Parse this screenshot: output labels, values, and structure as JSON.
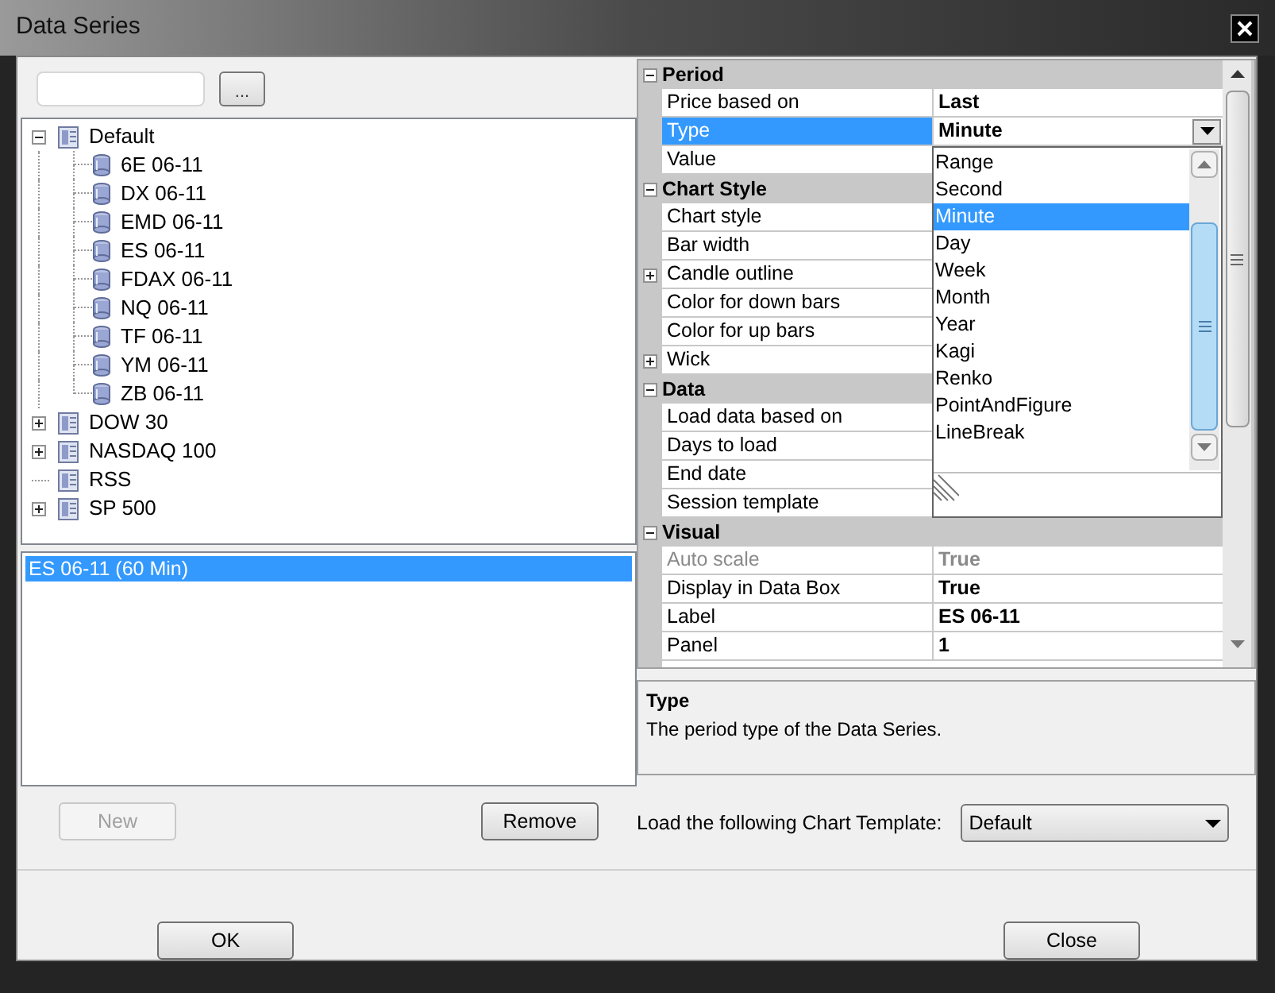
{
  "window": {
    "title": "Data Series"
  },
  "browse_button": "...",
  "tree": [
    {
      "label": "Default",
      "kind": "group",
      "expanded": true,
      "children": [
        {
          "label": "6E 06-11"
        },
        {
          "label": "DX 06-11"
        },
        {
          "label": "EMD 06-11"
        },
        {
          "label": "ES 06-11"
        },
        {
          "label": "FDAX 06-11"
        },
        {
          "label": "NQ 06-11"
        },
        {
          "label": "TF 06-11"
        },
        {
          "label": "YM 06-11"
        },
        {
          "label": "ZB 06-11"
        }
      ]
    },
    {
      "label": "DOW 30",
      "kind": "group",
      "expanded": false
    },
    {
      "label": "NASDAQ 100",
      "kind": "group",
      "expanded": false
    },
    {
      "label": "RSS",
      "kind": "leaf"
    },
    {
      "label": "SP 500",
      "kind": "group",
      "expanded": false
    }
  ],
  "series_list": [
    {
      "label": "ES 06-11 (60 Min)",
      "selected": true
    }
  ],
  "list_buttons": [
    {
      "label": "New",
      "disabled": true
    },
    {
      "label": "Remove",
      "disabled": false
    }
  ],
  "properties": [
    {
      "name": "Period",
      "expanded": true,
      "rows": [
        {
          "name": "Price based on",
          "kind": "plain",
          "value": "Last",
          "selected": false,
          "disabled": false
        },
        {
          "name": "Type",
          "kind": "plain",
          "value": "Minute",
          "selected": true,
          "disabled": false,
          "dropdown": {
            "items": [
              {
                "label": "Range",
                "selected": false
              },
              {
                "label": "Second",
                "selected": false
              },
              {
                "label": "Minute",
                "selected": true
              },
              {
                "label": "Day",
                "selected": false
              },
              {
                "label": "Week",
                "selected": false
              },
              {
                "label": "Month",
                "selected": false
              },
              {
                "label": "Year",
                "selected": false
              },
              {
                "label": "Kagi",
                "selected": false
              },
              {
                "label": "Renko",
                "selected": false
              },
              {
                "label": "PointAndFigure",
                "selected": false
              },
              {
                "label": "LineBreak",
                "selected": false
              }
            ]
          }
        },
        {
          "name": "Value",
          "kind": "plain",
          "selected": false,
          "disabled": false
        }
      ]
    },
    {
      "name": "Chart Style",
      "expanded": true,
      "rows": [
        {
          "name": "Chart style",
          "kind": "plain",
          "selected": false,
          "disabled": false
        },
        {
          "name": "Bar width",
          "kind": "plain",
          "selected": false,
          "disabled": false
        },
        {
          "name": "Candle outline",
          "kind": "group",
          "selected": false,
          "disabled": false
        },
        {
          "name": "Color for down bars",
          "kind": "plain",
          "selected": false,
          "disabled": false
        },
        {
          "name": "Color for up bars",
          "kind": "plain",
          "selected": false,
          "disabled": false
        },
        {
          "name": "Wick",
          "kind": "group",
          "selected": false,
          "disabled": false
        }
      ]
    },
    {
      "name": "Data",
      "expanded": true,
      "rows": [
        {
          "name": "Load data based on",
          "kind": "plain",
          "selected": false,
          "disabled": false
        },
        {
          "name": "Days to load",
          "kind": "plain",
          "selected": false,
          "disabled": false
        },
        {
          "name": "End date",
          "kind": "plain",
          "selected": false,
          "disabled": false
        },
        {
          "name": "Session template",
          "kind": "plain",
          "selected": false,
          "disabled": false
        }
      ]
    },
    {
      "name": "Visual",
      "expanded": true,
      "rows": [
        {
          "name": "Auto scale",
          "kind": "plain",
          "value": "True",
          "selected": false,
          "disabled": true
        },
        {
          "name": "Display in Data Box",
          "kind": "plain",
          "value": "True",
          "selected": false,
          "disabled": false
        },
        {
          "name": "Label",
          "kind": "plain",
          "value": "ES 06-11",
          "selected": false,
          "disabled": false
        },
        {
          "name": "Panel",
          "kind": "plain",
          "value": "1",
          "selected": false,
          "disabled": false
        }
      ]
    }
  ],
  "description": {
    "title": "Type",
    "text": "The period type of the Data Series."
  },
  "template": {
    "label": "Load the following Chart Template:",
    "value": "Default"
  },
  "dialog_buttons": [
    "OK",
    "Close"
  ]
}
